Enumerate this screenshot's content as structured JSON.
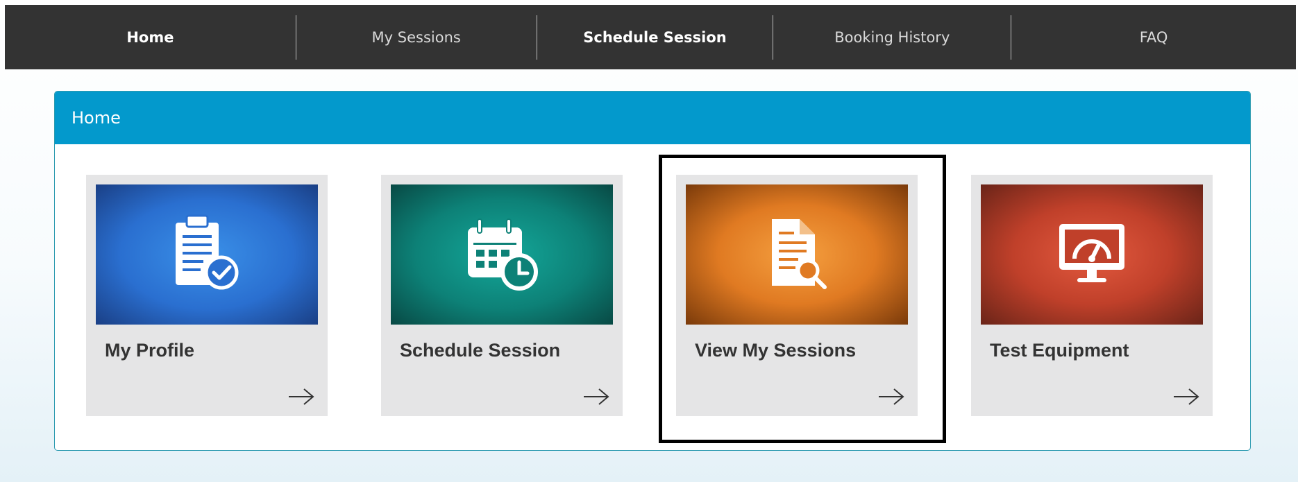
{
  "nav": {
    "items": [
      {
        "label": "Home"
      },
      {
        "label": "My Sessions"
      },
      {
        "label": "Schedule Session"
      },
      {
        "label": "Booking History"
      },
      {
        "label": "FAQ"
      }
    ]
  },
  "panel": {
    "title": "Home"
  },
  "cards": [
    {
      "title": "My Profile",
      "icon": "clipboard-check-icon",
      "color": "#2a6fd0"
    },
    {
      "title": "Schedule Session",
      "icon": "calendar-clock-icon",
      "color": "#0d8177"
    },
    {
      "title": "View My Sessions",
      "icon": "document-search-icon",
      "color": "#e07a22"
    },
    {
      "title": "Test Equipment",
      "icon": "monitor-gauge-icon",
      "color": "#c0402a"
    }
  ],
  "colors": {
    "nav_bg": "#333333",
    "panel_header": "#0399cc",
    "card_bg": "#e5e5e6",
    "highlight": "#000000"
  }
}
